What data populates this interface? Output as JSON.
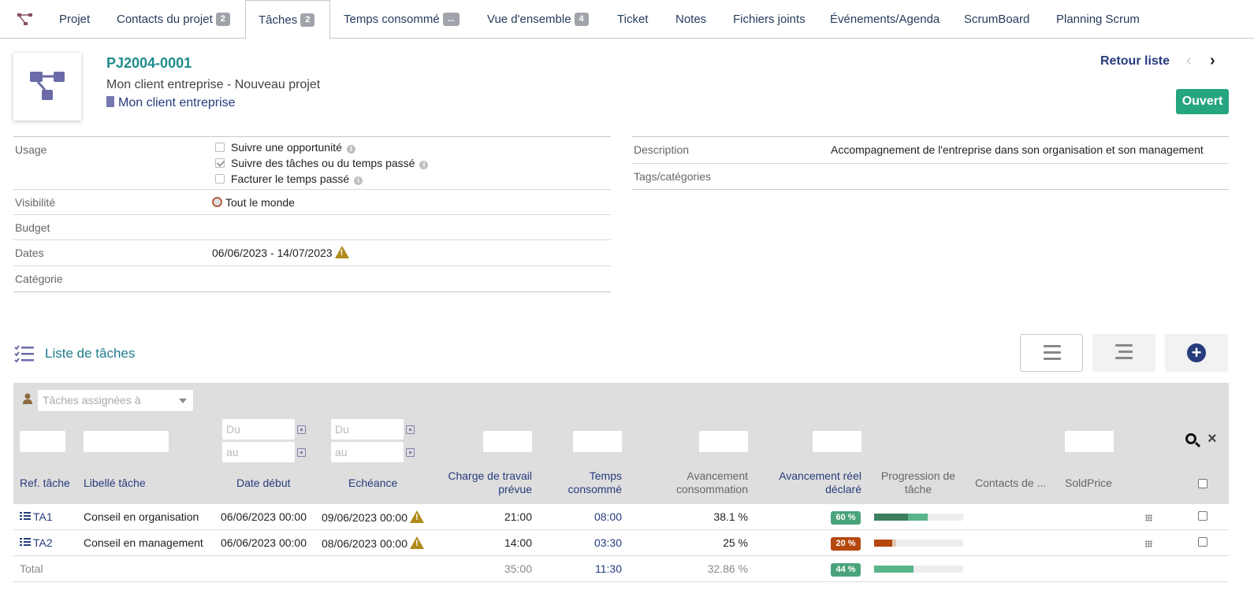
{
  "tabs": [
    {
      "label": "Projet",
      "badge": ""
    },
    {
      "label": "Contacts du projet",
      "badge": "2"
    },
    {
      "label": "Tâches",
      "badge": "2"
    },
    {
      "label": "Temps consommé",
      "badge": "..."
    },
    {
      "label": "Vue d'ensemble",
      "badge": "4"
    },
    {
      "label": "Ticket",
      "badge": ""
    },
    {
      "label": "Notes",
      "badge": ""
    },
    {
      "label": "Fichiers joints",
      "badge": ""
    },
    {
      "label": "Événements/Agenda",
      "badge": ""
    },
    {
      "label": "ScrumBoard",
      "badge": ""
    },
    {
      "label": "Planning Scrum",
      "badge": ""
    }
  ],
  "header": {
    "ref": "PJ2004-0001",
    "subtitle": "Mon client entreprise - Nouveau projet",
    "thirdparty": "Mon client entreprise",
    "back_link": "Retour liste",
    "prev": "‹",
    "next": "›",
    "status": "Ouvert"
  },
  "fields_left": {
    "usage_label": "Usage",
    "usage_opts": [
      "Suivre une opportunité",
      "Suivre des tâches ou du temps passé",
      "Facturer le temps passé"
    ],
    "visibility_label": "Visibilité",
    "visibility_value": "Tout le monde",
    "budget_label": "Budget",
    "dates_label": "Dates",
    "dates_value": "06/06/2023 - 14/07/2023",
    "category_label": "Catégorie"
  },
  "fields_right": {
    "description_label": "Description",
    "description_value": "Accompagnement de l'entreprise dans son organisation et son management",
    "tags_label": "Tags/catégories"
  },
  "tasklist": {
    "title": "Liste de tâches",
    "add_symbol": "+",
    "assign_placeholder": "Tâches assignées à",
    "from_placeholder": "Du",
    "to_placeholder": "au",
    "clear_symbol": "×",
    "columns": [
      "Ref. tâche",
      "Libellé tâche",
      "Date début",
      "Echéance",
      "Charge de travail",
      "prévue",
      "Temps",
      "consommé",
      "Avancement",
      "consommation",
      "Avancement réel",
      "déclaré",
      "Progression de",
      "tâche",
      "Contacts de ...",
      "SoldPrice"
    ],
    "rows": [
      {
        "ref": "TA1",
        "label": "Conseil en organisation",
        "start": "06/06/2023 00:00",
        "end": "09/06/2023 00:00",
        "planned": "21:00",
        "spent": "08:00",
        "progress_calc": "38.1 %",
        "progress_declared": "60 %",
        "declared_frac": 0.6,
        "calc_frac": 0.381,
        "badge_color": "#4aa37a"
      },
      {
        "ref": "TA2",
        "label": "Conseil en management",
        "start": "06/06/2023 00:00",
        "end": "08/06/2023 00:00",
        "planned": "14:00",
        "spent": "03:30",
        "progress_calc": "25 %",
        "progress_declared": "20 %",
        "declared_frac": 0.2,
        "calc_frac": 0.25,
        "badge_color": "#b5480e"
      }
    ],
    "total": {
      "label": "Total",
      "planned": "35:00",
      "spent": "11:30",
      "progress_calc": "32.86 %",
      "progress_declared": "44 %",
      "declared_frac": 0.44
    }
  },
  "colors": {
    "accent": "#263c7c",
    "teal": "#1e8c8c",
    "status_green": "#25a580"
  }
}
